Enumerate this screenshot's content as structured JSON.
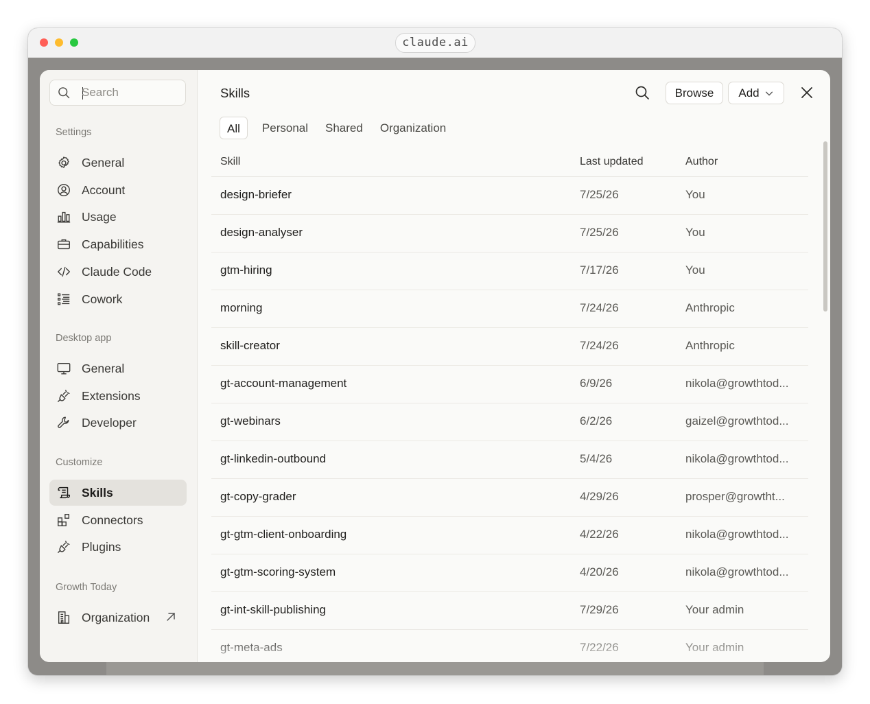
{
  "browser": {
    "url": "claude.ai"
  },
  "sidebar": {
    "search_placeholder": "Search",
    "sections": [
      {
        "label": "Settings",
        "items": [
          {
            "label": "General",
            "icon": "gear-icon"
          },
          {
            "label": "Account",
            "icon": "user-circle-icon"
          },
          {
            "label": "Usage",
            "icon": "bar-chart-icon"
          },
          {
            "label": "Capabilities",
            "icon": "briefcase-icon"
          },
          {
            "label": "Claude Code",
            "icon": "code-icon"
          },
          {
            "label": "Cowork",
            "icon": "checklist-icon"
          }
        ]
      },
      {
        "label": "Desktop app",
        "items": [
          {
            "label": "General",
            "icon": "monitor-icon"
          },
          {
            "label": "Extensions",
            "icon": "plug-icon"
          },
          {
            "label": "Developer",
            "icon": "wrench-icon"
          }
        ]
      },
      {
        "label": "Customize",
        "items": [
          {
            "label": "Skills",
            "icon": "scroll-icon",
            "active": true
          },
          {
            "label": "Connectors",
            "icon": "connector-icon"
          },
          {
            "label": "Plugins",
            "icon": "plug-icon"
          }
        ]
      },
      {
        "label": "Growth Today",
        "items": [
          {
            "label": "Organization",
            "icon": "building-icon",
            "external": true
          }
        ]
      }
    ]
  },
  "main": {
    "title": "Skills",
    "browse_label": "Browse",
    "add_label": "Add",
    "tabs": [
      {
        "label": "All",
        "active": true
      },
      {
        "label": "Personal"
      },
      {
        "label": "Shared"
      },
      {
        "label": "Organization"
      }
    ],
    "table": {
      "columns": {
        "skill": "Skill",
        "last_updated": "Last updated",
        "author": "Author"
      },
      "rows": [
        {
          "skill": "design-briefer",
          "updated": "7/25/26",
          "author": "You"
        },
        {
          "skill": "design-analyser",
          "updated": "7/25/26",
          "author": "You"
        },
        {
          "skill": "gtm-hiring",
          "updated": "7/17/26",
          "author": "You"
        },
        {
          "skill": "morning",
          "updated": "7/24/26",
          "author": "Anthropic"
        },
        {
          "skill": "skill-creator",
          "updated": "7/24/26",
          "author": "Anthropic"
        },
        {
          "skill": "gt-account-management",
          "updated": "6/9/26",
          "author": "nikola@growthtod..."
        },
        {
          "skill": "gt-webinars",
          "updated": "6/2/26",
          "author": "gaizel@growthtod..."
        },
        {
          "skill": "gt-linkedin-outbound",
          "updated": "5/4/26",
          "author": "nikola@growthtod..."
        },
        {
          "skill": "gt-copy-grader",
          "updated": "4/29/26",
          "author": "prosper@growtht..."
        },
        {
          "skill": "gt-gtm-client-onboarding",
          "updated": "4/22/26",
          "author": "nikola@growthtod..."
        },
        {
          "skill": "gt-gtm-scoring-system",
          "updated": "4/20/26",
          "author": "nikola@growthtod..."
        },
        {
          "skill": "gt-int-skill-publishing",
          "updated": "7/29/26",
          "author": "Your admin"
        },
        {
          "skill": "gt-meta-ads",
          "updated": "7/22/26",
          "author": "Your admin"
        }
      ]
    }
  }
}
